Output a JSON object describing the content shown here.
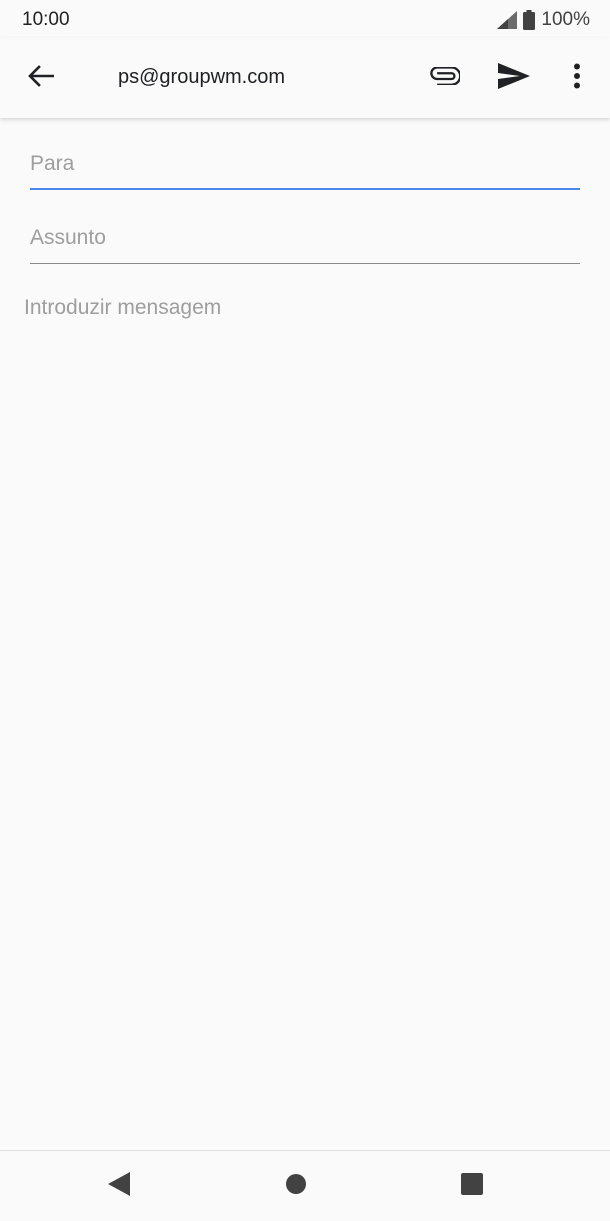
{
  "status_bar": {
    "time": "10:00",
    "battery": "100%"
  },
  "app_bar": {
    "from_account": "ps@groupwm.com",
    "icons": {
      "back": "arrow-back-icon",
      "attach": "paperclip-icon",
      "send": "send-icon",
      "more": "more-vert-icon"
    }
  },
  "compose": {
    "to_placeholder": "Para",
    "to_value": "",
    "subject_placeholder": "Assunto",
    "subject_value": "",
    "body_placeholder": "Introduzir mensagem",
    "body_value": ""
  },
  "colors": {
    "accent": "#4a86e8",
    "background": "#fafafa"
  }
}
